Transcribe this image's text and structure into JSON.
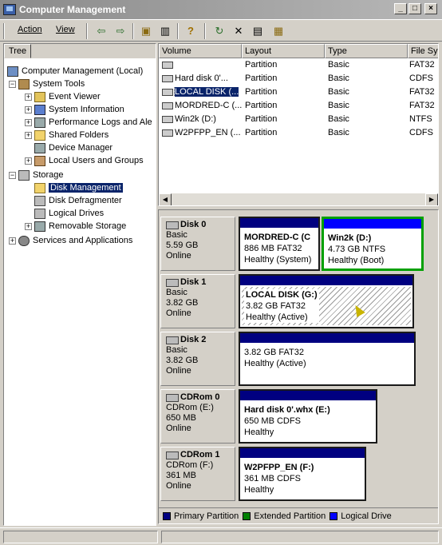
{
  "window": {
    "title": "Computer Management"
  },
  "menu": {
    "action": "Action",
    "view": "View"
  },
  "toolbar": {
    "icons": [
      "back-arrow-icon",
      "forward-arrow-icon",
      "up-folder-icon",
      "show-hide-tree-icon",
      "help-icon",
      "refresh-icon",
      "delete-icon",
      "properties-icon",
      "export-icon"
    ],
    "glyphs": [
      "⇦",
      "⇨",
      "▣",
      "▥",
      "?",
      "↻",
      "✕",
      "▤",
      "▦"
    ]
  },
  "tree": {
    "tab_label": "Tree",
    "items": [
      {
        "label": "Computer Management (Local)"
      },
      {
        "label": "System Tools"
      },
      {
        "label": "Event Viewer"
      },
      {
        "label": "System Information"
      },
      {
        "label": "Performance Logs and Ale"
      },
      {
        "label": "Shared Folders"
      },
      {
        "label": "Device Manager"
      },
      {
        "label": "Local Users and Groups"
      },
      {
        "label": "Storage"
      },
      {
        "label": "Disk Management"
      },
      {
        "label": "Disk Defragmenter"
      },
      {
        "label": "Logical Drives"
      },
      {
        "label": "Removable Storage"
      },
      {
        "label": "Services and Applications"
      }
    ]
  },
  "volume_list": {
    "columns": [
      "Volume",
      "Layout",
      "Type",
      "File Sys"
    ],
    "rows": [
      {
        "volume": "",
        "layout": "Partition",
        "type": "Basic",
        "fs": "FAT32"
      },
      {
        "volume": "Hard disk 0'...",
        "layout": "Partition",
        "type": "Basic",
        "fs": "CDFS"
      },
      {
        "volume": "LOCAL DISK (...",
        "layout": "Partition",
        "type": "Basic",
        "fs": "FAT32"
      },
      {
        "volume": "MORDRED-C (...",
        "layout": "Partition",
        "type": "Basic",
        "fs": "FAT32"
      },
      {
        "volume": "Win2k (D:)",
        "layout": "Partition",
        "type": "Basic",
        "fs": "NTFS"
      },
      {
        "volume": "W2PFPP_EN (...",
        "layout": "Partition",
        "type": "Basic",
        "fs": "CDFS"
      }
    ]
  },
  "disks": [
    {
      "name": "Disk 0",
      "type": "Basic",
      "size": "5.59 GB",
      "status": "Online",
      "partitions": [
        {
          "name": "MORDRED-C (C",
          "detail": "886 MB FAT32",
          "status": "Healthy (System)"
        },
        {
          "name": "Win2k (D:)",
          "detail": "4.73 GB NTFS",
          "status": "Healthy (Boot)"
        }
      ]
    },
    {
      "name": "Disk 1",
      "type": "Basic",
      "size": "3.82 GB",
      "status": "Online",
      "partitions": [
        {
          "name": "LOCAL DISK (G:)",
          "detail": "3.82 GB FAT32",
          "status": "Healthy (Active)"
        }
      ]
    },
    {
      "name": "Disk 2",
      "type": "Basic",
      "size": "3.82 GB",
      "status": "Online",
      "partitions": [
        {
          "name": "",
          "detail": "3.82 GB FAT32",
          "status": "Healthy (Active)"
        }
      ]
    },
    {
      "name": "CDRom 0",
      "type": "CDRom (E:)",
      "size": "650 MB",
      "status": "Online",
      "partitions": [
        {
          "name": "Hard disk 0'.whx (E:)",
          "detail": "650 MB CDFS",
          "status": "Healthy"
        }
      ]
    },
    {
      "name": "CDRom 1",
      "type": "CDRom (F:)",
      "size": "361 MB",
      "status": "Online",
      "partitions": [
        {
          "name": "W2PFPP_EN (F:)",
          "detail": "361 MB CDFS",
          "status": "Healthy"
        }
      ]
    }
  ],
  "legend": [
    {
      "label": "Primary Partition",
      "color": "#000080"
    },
    {
      "label": "Extended Partition",
      "color": "#008000"
    },
    {
      "label": "Logical Drive",
      "color": "#0000ff"
    }
  ],
  "colors": {
    "primary_bar": "#000080",
    "logical_bar": "#0000ff",
    "extended_outline": "#00a000"
  }
}
